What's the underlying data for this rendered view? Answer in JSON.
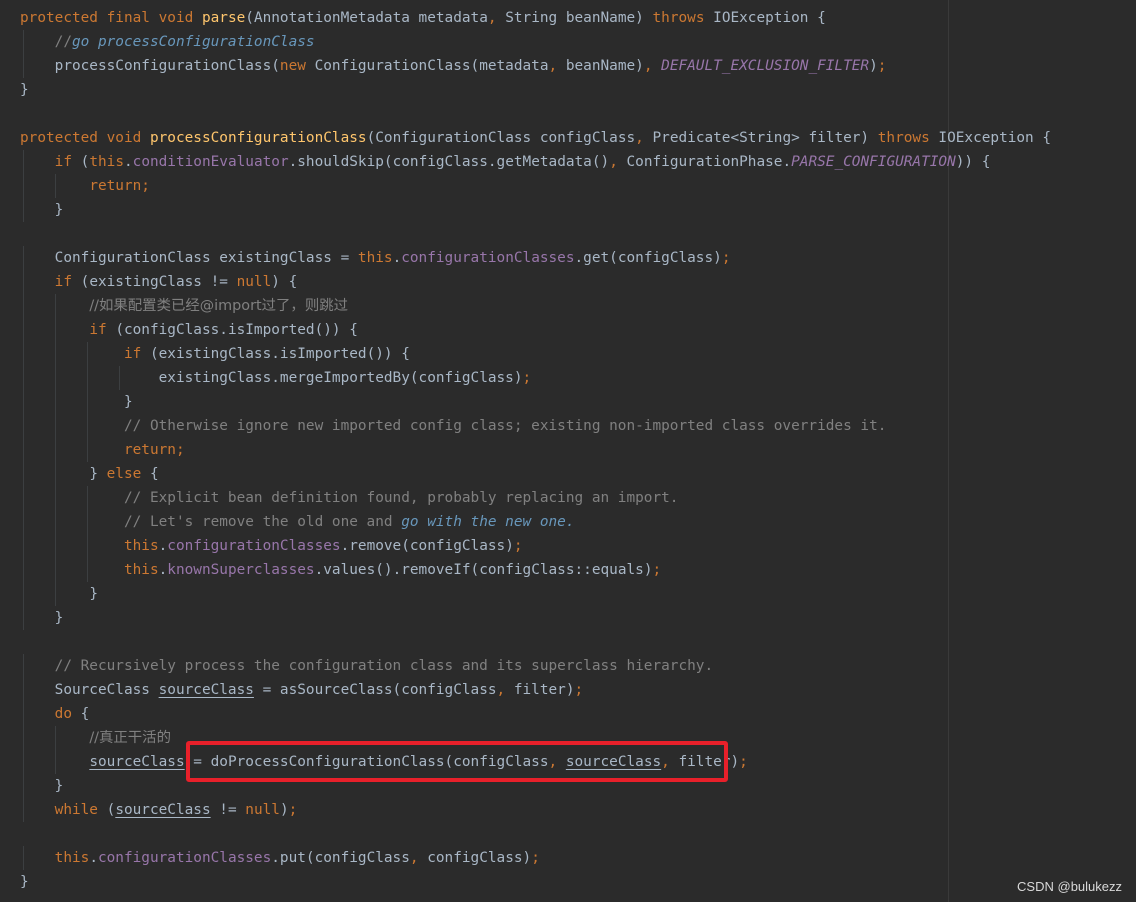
{
  "watermark": "CSDN @bulukezz",
  "highlight_color": "#e8202a",
  "lines": [
    {
      "indent": 0,
      "tokens": [
        [
          "kw",
          "protected final void "
        ],
        [
          "fn",
          "parse"
        ],
        [
          "plain",
          "(AnnotationMetadata metadata"
        ],
        [
          "kw",
          ", "
        ],
        [
          "plain",
          "String beanName) "
        ],
        [
          "kw",
          "throws "
        ],
        [
          "plain",
          "IOException {"
        ]
      ]
    },
    {
      "indent": 1,
      "tokens": [
        [
          "comment",
          "//"
        ],
        [
          "cmt-kw",
          "go processConfigurationClass"
        ]
      ]
    },
    {
      "indent": 1,
      "tokens": [
        [
          "plain",
          "processConfigurationClass("
        ],
        [
          "kw",
          "new "
        ],
        [
          "plain",
          "ConfigurationClass(metadata"
        ],
        [
          "kw",
          ", "
        ],
        [
          "plain",
          "beanName)"
        ],
        [
          "kw",
          ", "
        ],
        [
          "static",
          "DEFAULT_EXCLUSION_FILTER"
        ],
        [
          "plain",
          ")"
        ],
        [
          "kw",
          ";"
        ]
      ]
    },
    {
      "indent": 0,
      "tokens": [
        [
          "plain",
          "}"
        ]
      ]
    },
    {
      "indent": 0,
      "tokens": []
    },
    {
      "indent": 0,
      "tokens": [
        [
          "kw",
          "protected void "
        ],
        [
          "fn",
          "processConfigurationClass"
        ],
        [
          "plain",
          "(ConfigurationClass configClass"
        ],
        [
          "kw",
          ", "
        ],
        [
          "plain",
          "Predicate<String> filter) "
        ],
        [
          "kw",
          "throws "
        ],
        [
          "plain",
          "IOException {"
        ]
      ]
    },
    {
      "indent": 1,
      "tokens": [
        [
          "kw",
          "if "
        ],
        [
          "plain",
          "("
        ],
        [
          "kw",
          "this"
        ],
        [
          "plain",
          "."
        ],
        [
          "field",
          "conditionEvaluator"
        ],
        [
          "plain",
          ".shouldSkip(configClass.getMetadata()"
        ],
        [
          "kw",
          ", "
        ],
        [
          "plain",
          "ConfigurationPhase."
        ],
        [
          "static",
          "PARSE_CONFIGURATION"
        ],
        [
          "plain",
          ")) {"
        ]
      ]
    },
    {
      "indent": 2,
      "tokens": [
        [
          "kw",
          "return;"
        ]
      ]
    },
    {
      "indent": 1,
      "tokens": [
        [
          "plain",
          "}"
        ]
      ]
    },
    {
      "indent": 0,
      "tokens": []
    },
    {
      "indent": 1,
      "tokens": [
        [
          "plain",
          "ConfigurationClass existingClass = "
        ],
        [
          "kw",
          "this"
        ],
        [
          "plain",
          "."
        ],
        [
          "field",
          "configurationClasses"
        ],
        [
          "plain",
          ".get(configClass)"
        ],
        [
          "kw",
          ";"
        ]
      ]
    },
    {
      "indent": 1,
      "tokens": [
        [
          "kw",
          "if "
        ],
        [
          "plain",
          "(existingClass != "
        ],
        [
          "kw",
          "null"
        ],
        [
          "plain",
          ") {"
        ]
      ]
    },
    {
      "indent": 2,
      "tokens": [
        [
          "comment",
          "//如果配置类已经@import过了，则跳过"
        ]
      ]
    },
    {
      "indent": 2,
      "tokens": [
        [
          "kw",
          "if "
        ],
        [
          "plain",
          "(configClass.isImported()) {"
        ]
      ]
    },
    {
      "indent": 3,
      "tokens": [
        [
          "kw",
          "if "
        ],
        [
          "plain",
          "(existingClass.isImported()) {"
        ]
      ]
    },
    {
      "indent": 4,
      "tokens": [
        [
          "plain",
          "existingClass.mergeImportedBy(configClass)"
        ],
        [
          "kw",
          ";"
        ]
      ]
    },
    {
      "indent": 3,
      "tokens": [
        [
          "plain",
          "}"
        ]
      ]
    },
    {
      "indent": 3,
      "tokens": [
        [
          "comment",
          "// Otherwise ignore new imported config class; existing non-imported class overrides it."
        ]
      ]
    },
    {
      "indent": 3,
      "tokens": [
        [
          "kw",
          "return;"
        ]
      ]
    },
    {
      "indent": 2,
      "tokens": [
        [
          "plain",
          "} "
        ],
        [
          "kw",
          "else "
        ],
        [
          "plain",
          "{"
        ]
      ]
    },
    {
      "indent": 3,
      "tokens": [
        [
          "comment",
          "// Explicit bean definition found, probably replacing an import."
        ]
      ]
    },
    {
      "indent": 3,
      "tokens": [
        [
          "comment",
          "// Let's remove the old one and "
        ],
        [
          "cmt-kw",
          "go with the new one."
        ]
      ]
    },
    {
      "indent": 3,
      "tokens": [
        [
          "kw",
          "this"
        ],
        [
          "plain",
          "."
        ],
        [
          "field",
          "configurationClasses"
        ],
        [
          "plain",
          ".remove(configClass)"
        ],
        [
          "kw",
          ";"
        ]
      ]
    },
    {
      "indent": 3,
      "tokens": [
        [
          "kw",
          "this"
        ],
        [
          "plain",
          "."
        ],
        [
          "field",
          "knownSuperclasses"
        ],
        [
          "plain",
          ".values().removeIf(configClass::equals)"
        ],
        [
          "kw",
          ";"
        ]
      ]
    },
    {
      "indent": 2,
      "tokens": [
        [
          "plain",
          "}"
        ]
      ]
    },
    {
      "indent": 1,
      "tokens": [
        [
          "plain",
          "}"
        ]
      ]
    },
    {
      "indent": 0,
      "tokens": []
    },
    {
      "indent": 1,
      "tokens": [
        [
          "comment",
          "// Recursively process the configuration class and its superclass hierarchy."
        ]
      ]
    },
    {
      "indent": 1,
      "tokens": [
        [
          "plain",
          "SourceClass "
        ],
        [
          "var-ul",
          "sourceClass"
        ],
        [
          "plain",
          " = asSourceClass(configClass"
        ],
        [
          "kw",
          ", "
        ],
        [
          "plain",
          "filter)"
        ],
        [
          "kw",
          ";"
        ]
      ]
    },
    {
      "indent": 1,
      "tokens": [
        [
          "kw",
          "do "
        ],
        [
          "plain",
          "{"
        ]
      ]
    },
    {
      "indent": 2,
      "tokens": [
        [
          "comment",
          "//真正干活的"
        ]
      ]
    },
    {
      "indent": 2,
      "tokens": [
        [
          "var-ul",
          "sourceClass"
        ],
        [
          "plain",
          " = doProcessConfigurationClass(configClass"
        ],
        [
          "kw",
          ", "
        ],
        [
          "var-ul",
          "sourceClass"
        ],
        [
          "kw",
          ", "
        ],
        [
          "plain",
          "filter)"
        ],
        [
          "kw",
          ";"
        ]
      ]
    },
    {
      "indent": 1,
      "tokens": [
        [
          "plain",
          "}"
        ]
      ]
    },
    {
      "indent": 1,
      "tokens": [
        [
          "kw",
          "while "
        ],
        [
          "plain",
          "("
        ],
        [
          "var-ul",
          "sourceClass"
        ],
        [
          "plain",
          " != "
        ],
        [
          "kw",
          "null"
        ],
        [
          "plain",
          ")"
        ],
        [
          "kw",
          ";"
        ]
      ]
    },
    {
      "indent": 0,
      "tokens": []
    },
    {
      "indent": 1,
      "tokens": [
        [
          "kw",
          "this"
        ],
        [
          "plain",
          "."
        ],
        [
          "field",
          "configurationClasses"
        ],
        [
          "plain",
          ".put(configClass"
        ],
        [
          "kw",
          ", "
        ],
        [
          "plain",
          "configClass)"
        ],
        [
          "kw",
          ";"
        ]
      ]
    },
    {
      "indent": 0,
      "tokens": [
        [
          "plain",
          "}"
        ]
      ]
    }
  ]
}
